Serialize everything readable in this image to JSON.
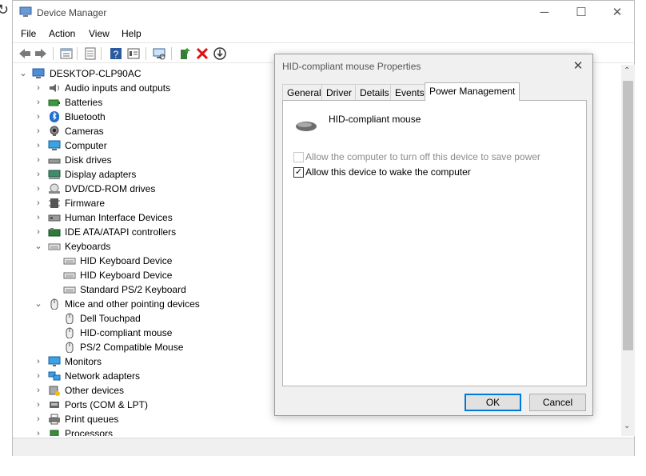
{
  "window": {
    "title": "Device Manager",
    "min": "─",
    "max": "☐",
    "close": "✕"
  },
  "menu": [
    "File",
    "Action",
    "View",
    "Help"
  ],
  "tree": {
    "root": "DESKTOP-CLP90AC",
    "items": [
      {
        "label": "Audio inputs and outputs",
        "icon": "speaker-icon",
        "level": 1,
        "chev": "›"
      },
      {
        "label": "Batteries",
        "icon": "battery-icon",
        "level": 1,
        "chev": "›"
      },
      {
        "label": "Bluetooth",
        "icon": "bluetooth-icon",
        "level": 1,
        "chev": "›"
      },
      {
        "label": "Cameras",
        "icon": "camera-icon",
        "level": 1,
        "chev": "›"
      },
      {
        "label": "Computer",
        "icon": "computer-icon",
        "level": 1,
        "chev": "›"
      },
      {
        "label": "Disk drives",
        "icon": "disk-drive-icon",
        "level": 1,
        "chev": "›"
      },
      {
        "label": "Display adapters",
        "icon": "display-adapter-icon",
        "level": 1,
        "chev": "›"
      },
      {
        "label": "DVD/CD-ROM drives",
        "icon": "dvd-drive-icon",
        "level": 1,
        "chev": "›"
      },
      {
        "label": "Firmware",
        "icon": "firmware-icon",
        "level": 1,
        "chev": "›"
      },
      {
        "label": "Human Interface Devices",
        "icon": "hid-icon",
        "level": 1,
        "chev": "›"
      },
      {
        "label": "IDE ATA/ATAPI controllers",
        "icon": "ide-controller-icon",
        "level": 1,
        "chev": "›"
      },
      {
        "label": "Keyboards",
        "icon": "keyboard-icon",
        "level": 1,
        "chev": "⌄"
      },
      {
        "label": "HID Keyboard Device",
        "icon": "keyboard-icon",
        "level": 2,
        "chev": ""
      },
      {
        "label": "HID Keyboard Device",
        "icon": "keyboard-icon",
        "level": 2,
        "chev": ""
      },
      {
        "label": "Standard PS/2 Keyboard",
        "icon": "keyboard-icon",
        "level": 2,
        "chev": ""
      },
      {
        "label": "Mice and other pointing devices",
        "icon": "mouse-icon",
        "level": 1,
        "chev": "⌄"
      },
      {
        "label": "Dell Touchpad",
        "icon": "mouse-icon",
        "level": 2,
        "chev": ""
      },
      {
        "label": "HID-compliant mouse",
        "icon": "mouse-icon",
        "level": 2,
        "chev": ""
      },
      {
        "label": "PS/2 Compatible Mouse",
        "icon": "mouse-icon",
        "level": 2,
        "chev": ""
      },
      {
        "label": "Monitors",
        "icon": "monitor-icon",
        "level": 1,
        "chev": "›"
      },
      {
        "label": "Network adapters",
        "icon": "network-adapter-icon",
        "level": 1,
        "chev": "›"
      },
      {
        "label": "Other devices",
        "icon": "other-devices-icon",
        "level": 1,
        "chev": "›"
      },
      {
        "label": "Ports (COM & LPT)",
        "icon": "port-icon",
        "level": 1,
        "chev": "›"
      },
      {
        "label": "Print queues",
        "icon": "printer-icon",
        "level": 1,
        "chev": "›"
      },
      {
        "label": "Processors",
        "icon": "processor-icon",
        "level": 1,
        "chev": "›"
      }
    ]
  },
  "dialog": {
    "title": "HID-compliant mouse Properties",
    "close": "✕",
    "tabs": [
      "General",
      "Driver",
      "Details",
      "Events",
      "Power Management"
    ],
    "active_tab": "Power Management",
    "device_name": "HID-compliant mouse",
    "options": [
      {
        "label": "Allow the computer to turn off this device to save power",
        "checked": false,
        "disabled": true
      },
      {
        "label": "Allow this device to wake the computer",
        "checked": true,
        "disabled": false
      }
    ],
    "ok": "OK",
    "cancel": "Cancel"
  },
  "colors": {
    "accent": "#0078d7",
    "dialog_bg": "#f0f0f0",
    "disabled_text": "#8c8c8c"
  }
}
